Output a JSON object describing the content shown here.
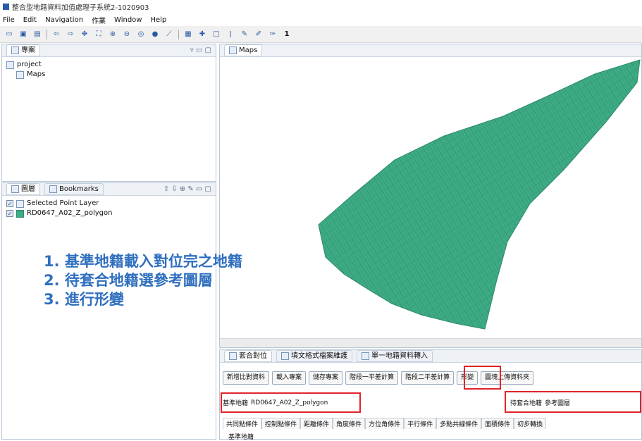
{
  "window": {
    "title": "整合型地籍資料加值處理子系統2-1020903"
  },
  "menu": [
    "File",
    "Edit",
    "Navigation",
    "作業",
    "Window",
    "Help"
  ],
  "toolbar": {
    "trailing_number": "1"
  },
  "project_panel": {
    "tab_label": "專案",
    "tree": {
      "root": "project",
      "child": "Maps"
    }
  },
  "layer_panel": {
    "tab_label": "圖層",
    "bookmarks_label": "Bookmarks",
    "layers": [
      "Selected Point Layer",
      "RD0647_A02_Z_polygon"
    ]
  },
  "map_panel": {
    "tab_label": "Maps",
    "polygon_color": "#3dac85"
  },
  "instructions": [
    "1. 基準地籍載入對位完之地籍",
    "2. 待套合地籍選參考圖層",
    "3. 進行形變"
  ],
  "bottom_panel": {
    "tabs": [
      "套合對位",
      "填文格式檔案維護",
      "單一地籍資料轉入"
    ],
    "buttons": [
      "新增比對資料",
      "載入專案",
      "儲存專案",
      "階段一平差計算",
      "階段二平差計算",
      "形變",
      "圖塊上傳資料夾"
    ],
    "base_label": "基準地籍",
    "base_value": "RD0647_A02_Z_polygon",
    "target_label": "待套合地籍",
    "target_value": "參考圖層",
    "subtabs": [
      "共同點條件",
      "控制點條件",
      "距離條件",
      "角度條件",
      "方位角條件",
      "平行條件",
      "多點共線條件",
      "面積條件",
      "初步轉換"
    ],
    "section_label": "基準地籍"
  },
  "colors": {
    "highlight_red": "#e0242a",
    "instruction_blue": "#2f6fbf"
  }
}
